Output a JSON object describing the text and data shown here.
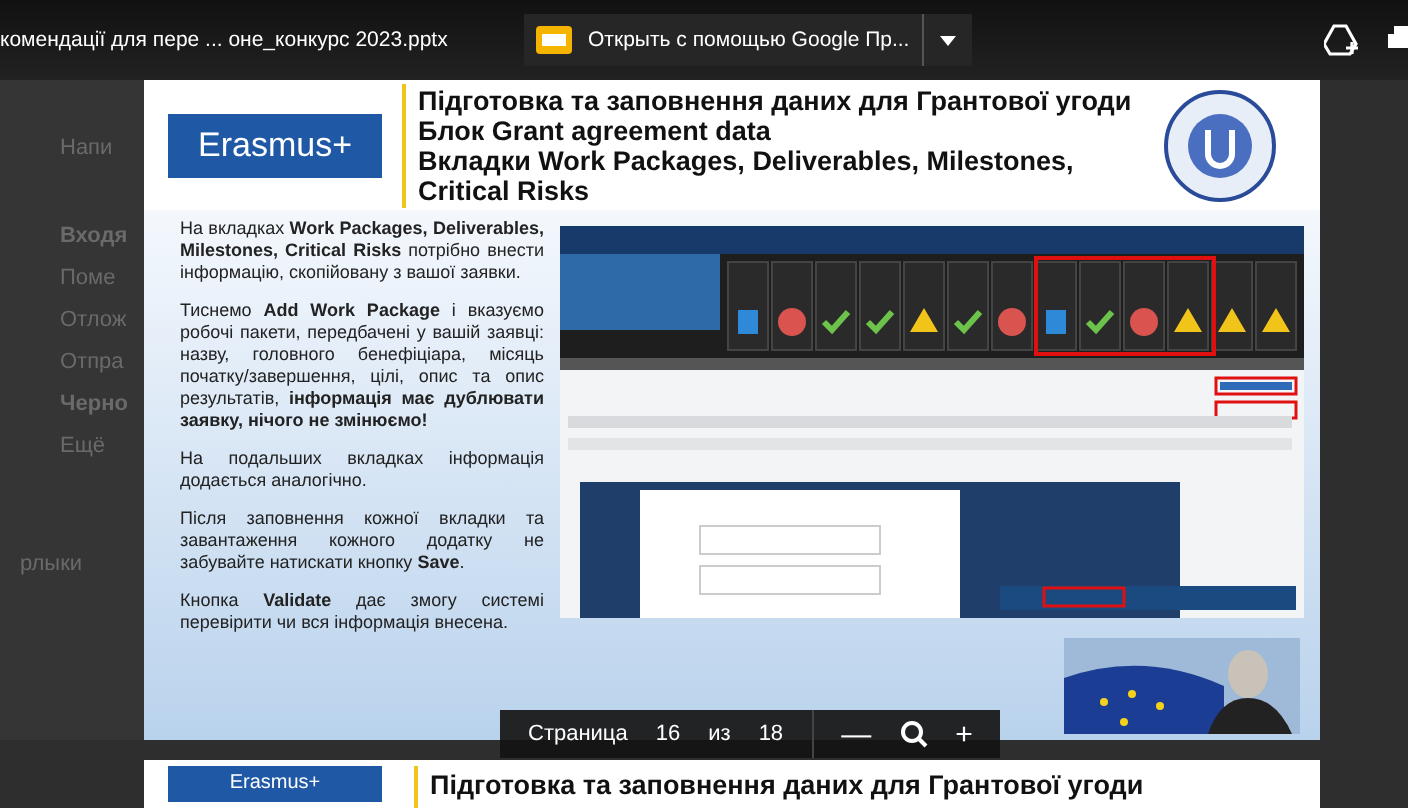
{
  "viewer": {
    "file_name": "комендації для пере ... оне_конкурс 2023.pptx",
    "open_with": "Открыть с помощью Google Пр..."
  },
  "background_sidebar": [
    {
      "label": "Напи",
      "bold": false
    },
    {
      "label": "Входя",
      "bold": true
    },
    {
      "label": "Поме",
      "bold": false
    },
    {
      "label": "Отлож",
      "bold": false
    },
    {
      "label": "Отпра",
      "bold": false
    },
    {
      "label": "Черно",
      "bold": true
    },
    {
      "label": "Ещё",
      "bold": false
    },
    {
      "label": "рлыки",
      "bold": false
    }
  ],
  "slide": {
    "logo": "Erasmus+",
    "title_lines": [
      "Підготовка та заповнення даних для Грантової угоди",
      "Блок Grant agreement data",
      "Вкладки Work Packages, Deliverables, Milestones,",
      "Critical Risks"
    ],
    "paragraphs": [
      "На вкладках **Work Packages, Deliverables, Milestones, Critical Risks** потрібно внести інформацію, скопійовану з вашої заявки.",
      "Тиснемо **Add Work Package** і вказуємо робочі пакети, передбачені у вашій заявці: назву, головного бенефіціара, місяць початку/завершення, цілі, опис та опис результатів, **інформація має дублювати заявку, нічого не змінюємо!**",
      "На подальших вкладках інформація додається аналогічно.",
      "Після заповнення кожної вкладки та завантаження кожного додатку не забувайте натискати кнопку **Save**.",
      "Кнопка **Validate** дає змогу системі перевірити чи вся інформація внесена."
    ]
  },
  "next_slide": {
    "logo": "Erasmus+",
    "title": "Підготовка та заповнення даних для Грантової угоди"
  },
  "pager": {
    "label": "Страница",
    "current": "16",
    "of": "из",
    "total": "18",
    "zoom_out": "—",
    "zoom_in": "+"
  }
}
